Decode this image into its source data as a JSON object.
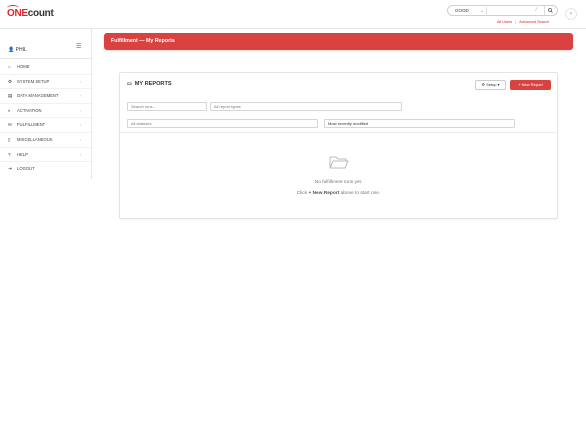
{
  "brand": {
    "one": "ONE",
    "count": "count"
  },
  "search": {
    "select_value": "GOOD",
    "input_value": "",
    "clear_glyph": "⁄",
    "button_icon": "search-icon"
  },
  "top_links": {
    "all_users": "All Users",
    "admin": "Advanced Search",
    "separator": "|"
  },
  "sidebar": {
    "user": "PHIL",
    "items": [
      {
        "label": "HOME",
        "icon": "home-icon",
        "has_arrow": false
      },
      {
        "label": "SYSTEM SETUP",
        "icon": "gear-icon",
        "has_arrow": true
      },
      {
        "label": "DATA MANAGEMENT",
        "icon": "database-icon",
        "has_arrow": true
      },
      {
        "label": "ACTIVATION",
        "icon": "toggle-icon",
        "has_arrow": true
      },
      {
        "label": "FULFILLMENT",
        "icon": "envelope-icon",
        "has_arrow": true
      },
      {
        "label": "MISCELLANEOUS",
        "icon": "file-icon",
        "has_arrow": true
      },
      {
        "label": "HELP",
        "icon": "question-icon",
        "has_arrow": true
      },
      {
        "label": "LOGOUT",
        "icon": "logout-icon",
        "has_arrow": false
      }
    ]
  },
  "page_header": {
    "title": "Fulfillment — My Reports"
  },
  "panel": {
    "title": "MY REPORTS",
    "setup_label": "Setup",
    "new_label": "New Report",
    "filters": {
      "search_placeholder": "Search runs...",
      "types_placeholder": "All report types",
      "statuses_placeholder": "All statuses",
      "sort_value": "Most recently modified"
    },
    "empty": {
      "main": "No fulfillment runs yet.",
      "sub_before": "Click",
      "sub_link": "+ New Report",
      "sub_after": "above to start one."
    }
  },
  "colors": {
    "accent": "#d9423e",
    "brand_red": "#e2242a"
  }
}
